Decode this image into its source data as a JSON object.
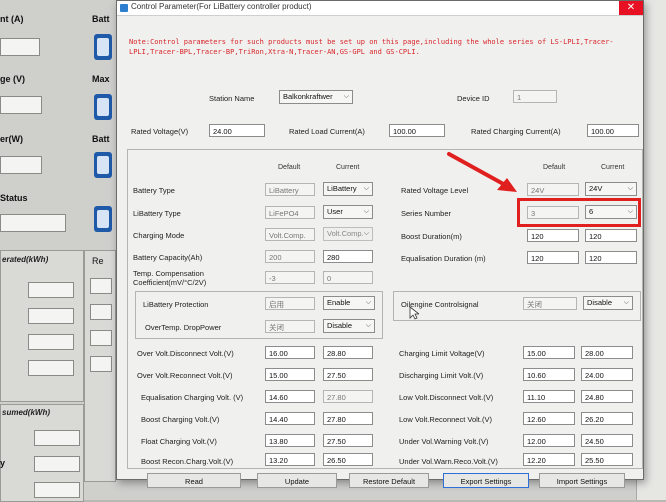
{
  "background": {
    "labels": [
      "nt (A)",
      "ge (V)",
      "er(W)",
      "Status",
      "Batt",
      "Max",
      "Batt",
      "erated(kWh)",
      "Re",
      "sumed(kWh)",
      "y"
    ]
  },
  "dialog": {
    "title": "Control Parameter(For LiBattery controller product)",
    "note": "Note:Control parameters for such products must be set up on this page,including the whole series of LS-LPLI,Tracer-LPLI,Tracer-BPL,Tracer-BP,TriRon,Xtra-N,Tracer-AN,GS-GPL and GS-CPLI.",
    "station_name_label": "Station Name",
    "station_name_value": "Balkonkraftwer",
    "device_id_label": "Device ID",
    "device_id_value": "1",
    "rated_voltage_label": "Rated Voltage(V)",
    "rated_voltage_value": "24.00",
    "rated_load_current_label": "Rated Load Current(A)",
    "rated_load_current_value": "100.00",
    "rated_charging_current_label": "Rated Charging Current(A)",
    "rated_charging_current_value": "100.00",
    "col_default": "Default",
    "col_current": "Current",
    "left": {
      "battery_type": {
        "label": "Battery Type",
        "default": "LiBattery",
        "current": "LiBattery"
      },
      "libattery_type": {
        "label": "LiBattery Type",
        "default": "LiFePO4",
        "current": "User"
      },
      "charging_mode": {
        "label": "Charging Mode",
        "default": "Volt.Comp.",
        "current": "Volt.Comp."
      },
      "battery_capacity": {
        "label": "Battery Capacity(Ah)",
        "default": "200",
        "current": "280"
      },
      "temp_comp": {
        "label": "Temp. Compensation Coefficient(mV/°C/2V)",
        "default": "-3",
        "current": "0"
      },
      "libattery_protection": {
        "label": "LiBattery Protection",
        "default": "启用",
        "current": "Enable"
      },
      "overtemp_droppower": {
        "label": "OverTemp. DropPower",
        "default": "关闭",
        "current": "Disable"
      },
      "over_volt_disconnect": {
        "label": "Over Volt.Disconnect Volt.(V)",
        "default": "16.00",
        "current": "28.80"
      },
      "over_volt_reconnect": {
        "label": "Over Volt.Reconnect Volt.(V)",
        "default": "15.00",
        "current": "27.50"
      },
      "equalisation_charging": {
        "label": "Equalisation Charging Volt. (V)",
        "default": "14.60",
        "current": "27.80"
      },
      "boost_charging": {
        "label": "Boost Charging Volt.(V)",
        "default": "14.40",
        "current": "27.80"
      },
      "float_charging": {
        "label": "Float Charging Volt.(V)",
        "default": "13.80",
        "current": "27.50"
      },
      "boost_recon": {
        "label": "Boost Recon.Charg.Volt.(V)",
        "default": "13.20",
        "current": "26.50"
      }
    },
    "right": {
      "rated_voltage_level": {
        "label": "Rated Voltage Level",
        "default": "24V",
        "current": "24V"
      },
      "series_number": {
        "label": "Series Number",
        "default": "3",
        "current": "6"
      },
      "boost_duration": {
        "label": "Boost Duration(m)",
        "default": "120",
        "current": "120"
      },
      "equalisation_duration": {
        "label": "Equalisation Duration (m)",
        "default": "120",
        "current": "120"
      },
      "oilengine": {
        "label": "Oilengine Controlsignal",
        "default": "关闭",
        "current": "Disable"
      },
      "charging_limit": {
        "label": "Charging Limit Voltage(V)",
        "default": "15.00",
        "current": "28.00"
      },
      "discharging_limit": {
        "label": "Discharging Limit Volt.(V)",
        "default": "10.60",
        "current": "24.00"
      },
      "low_volt_disconnect": {
        "label": "Low Volt.Disconnect Volt.(V)",
        "default": "11.10",
        "current": "24.80"
      },
      "low_volt_reconnect": {
        "label": "Low Volt.Reconnect Volt.(V)",
        "default": "12.60",
        "current": "26.20"
      },
      "under_vol_warning": {
        "label": "Under Vol.Warning Volt.(V)",
        "default": "12.00",
        "current": "24.50"
      },
      "under_vol_warn_reco": {
        "label": "Under Vol.Warn.Reco.Volt.(V)",
        "default": "12.20",
        "current": "25.50"
      }
    },
    "buttons": {
      "read": "Read",
      "update": "Update",
      "restore_default": "Restore Default",
      "export_settings": "Export Settings",
      "import_settings": "Import Settings"
    }
  }
}
